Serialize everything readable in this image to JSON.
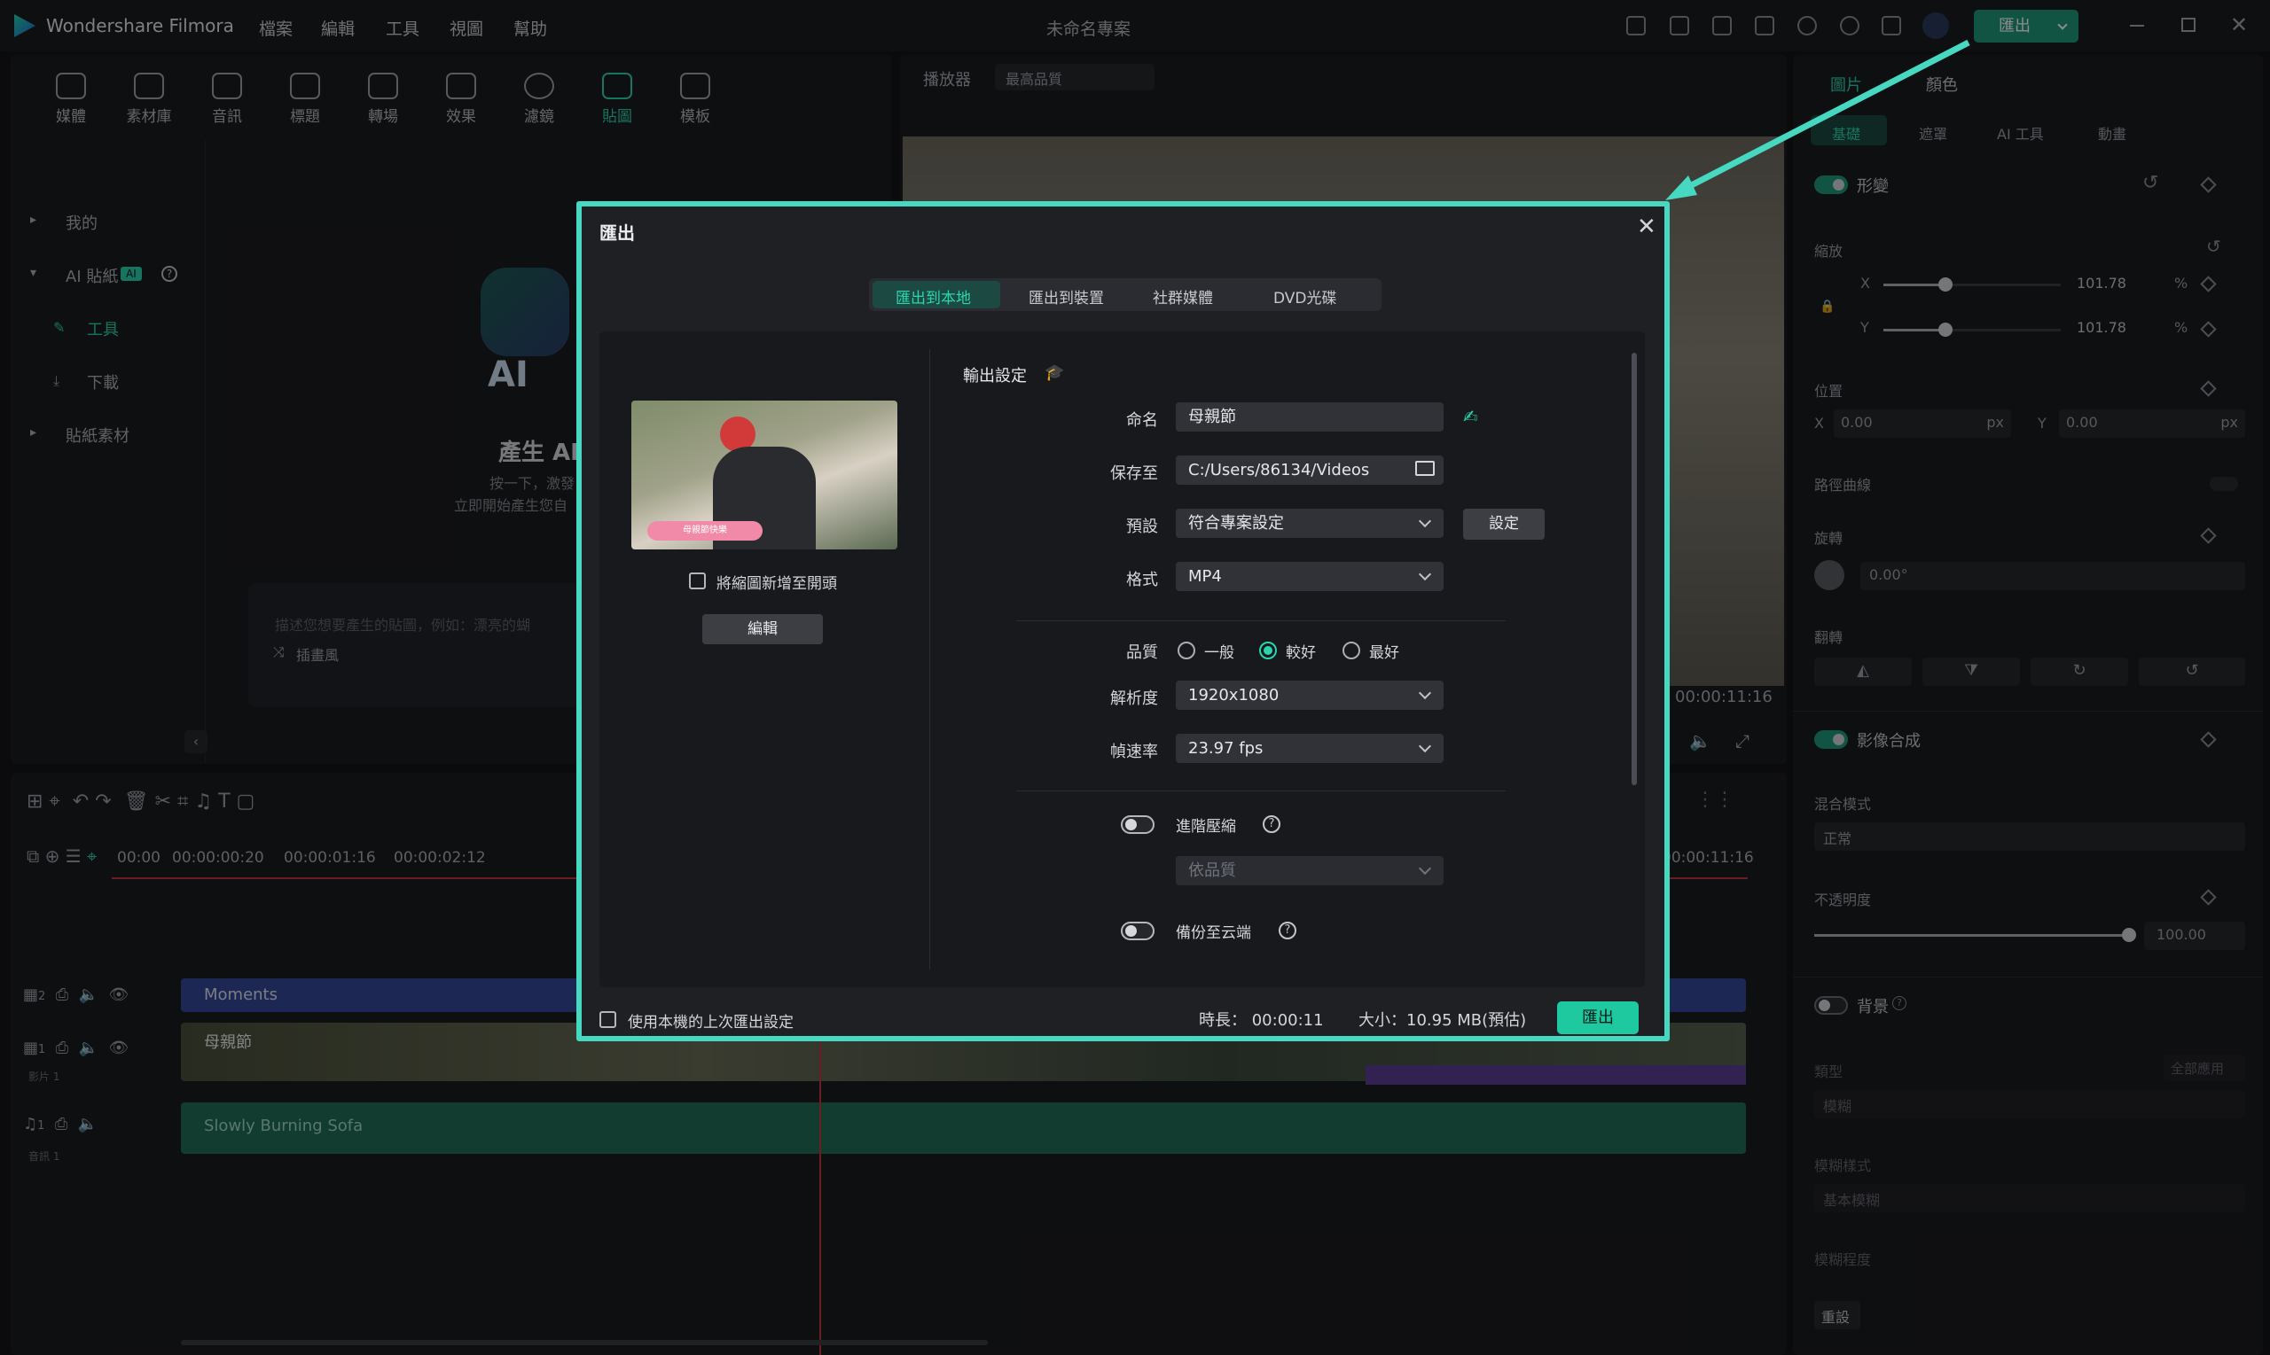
{
  "app": {
    "name": "Wondershare Filmora",
    "project_title": "未命名專案",
    "export_label": "匯出"
  },
  "menu": [
    "檔案",
    "編輯",
    "工具",
    "視圖",
    "幫助"
  ],
  "toolbar": [
    "媒體",
    "素材庫",
    "音訊",
    "標題",
    "轉場",
    "效果",
    "濾鏡",
    "貼圖",
    "模板"
  ],
  "toolbar_active": "貼圖",
  "sidebar": {
    "mine": "我的",
    "ai_stickers": "AI 貼紙",
    "ai_badge": "AI",
    "tools": "工具",
    "download": "下載",
    "sticker_assets": "貼紙素材"
  },
  "ai_panel": {
    "title": "產生 AI",
    "desc1": "按一下，激發",
    "desc2": "立即開始產生您自",
    "prompt_placeholder": "描述您想要產生的貼圖，例如：漂亮的蝴",
    "style": "插畫風"
  },
  "player": {
    "label": "播放器",
    "quality": "最高品質",
    "time": "00:00:11:16"
  },
  "timeline": {
    "ruler": [
      "00:00",
      "00:00:00:20",
      "00:00:01:16",
      "00:00:02:12",
      "00:00:11:16"
    ],
    "track2_clip": "Moments",
    "track1_clip": "母親節",
    "track1_sub": "影片 1",
    "audio_clip": "Slowly Burning Sofa",
    "audio_sub": "音訊 1",
    "track2_num": "2",
    "track1_num": "1",
    "audio_num": "1"
  },
  "props": {
    "tabs": [
      "圖片",
      "顏色"
    ],
    "subtabs": [
      "基礎",
      "遮罩",
      "AI 工具",
      "動畫"
    ],
    "transform": "形變",
    "scale": "縮放",
    "x_label": "X",
    "y_label": "Y",
    "scale_x": "101.78",
    "scale_y": "101.78",
    "percent": "%",
    "position": "位置",
    "pos_x": "0.00",
    "pos_y": "0.00",
    "px": "px",
    "path_curve": "路徑曲線",
    "rotate": "旋轉",
    "rotate_value": "0.00°",
    "flip": "翻轉",
    "compositing": "影像合成",
    "blend_mode": "混合模式",
    "blend_value": "正常",
    "opacity": "不透明度",
    "opacity_value": "100.00",
    "opacity_level": 1.0,
    "background": "背景",
    "bg_type": "類型",
    "bg_apply_all": "全部應用",
    "bg_type_value": "模糊",
    "blur_style": "模糊樣式",
    "blur_style_value": "基本模糊",
    "blur_level": "模糊程度",
    "reset": "重設"
  },
  "dialog": {
    "title": "匯出",
    "tabs": [
      "匯出到本地",
      "匯出到裝置",
      "社群媒體",
      "DVD光碟"
    ],
    "active_tab": "匯出到本地",
    "thumb_checkbox": "將縮圖新增至開頭",
    "edit_button": "編輯",
    "output_settings": "輸出設定",
    "name_label": "命名",
    "name_value": "母親節",
    "save_label": "保存至",
    "save_value": "C:/Users/86134/Videos",
    "preset_label": "預設",
    "preset_value": "符合專案設定",
    "settings_button": "設定",
    "format_label": "格式",
    "format_value": "MP4",
    "quality_label": "品質",
    "quality_options": [
      "一般",
      "較好",
      "最好"
    ],
    "quality_selected": "較好",
    "resolution_label": "解析度",
    "resolution_value": "1920x1080",
    "framerate_label": "幀速率",
    "framerate_value": "23.97 fps",
    "advanced_label": "進階壓縮",
    "advanced_value": "依品質",
    "backup_label": "備份至云端",
    "use_last_label": "使用本機的上次匯出設定",
    "duration_text": "時長： 00:00:11",
    "size_text": "大小：10.95 MB(預估)",
    "export_button": "匯出",
    "thumbnail_caption": "母親節快樂"
  },
  "colors": {
    "accent": "#2ad4ae",
    "dialog_border": "#46d8c0",
    "export_green": "#1f9a7d"
  }
}
